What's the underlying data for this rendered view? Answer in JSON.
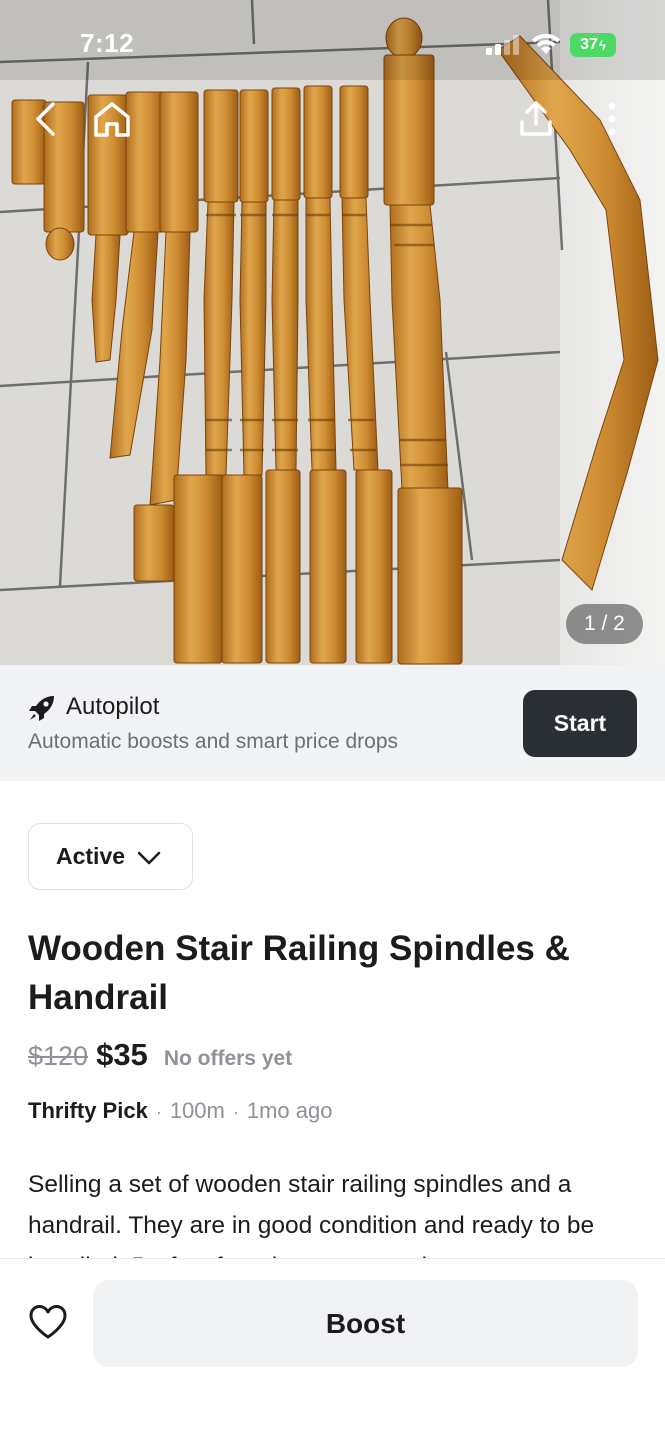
{
  "status_bar": {
    "time": "7:12",
    "battery": "37"
  },
  "hero": {
    "photo_subject": "wooden stair spindles and handrail",
    "counter": "1 / 2",
    "back_icon": "chevron-left-icon",
    "home_icon": "home-icon",
    "share_icon": "share-icon",
    "more_icon": "more-vertical-icon"
  },
  "autopilot": {
    "icon": "rocket-icon",
    "title": "Autopilot",
    "subtitle": "Automatic boosts and smart price drops",
    "start_label": "Start"
  },
  "listing": {
    "status": "Active",
    "title": "Wooden Stair Railing Spindles & Handrail",
    "original_price": "$120",
    "price": "$35",
    "offers": "No offers yet",
    "seller": "Thrifty Pick",
    "distance": "100m",
    "age": "1mo ago",
    "description": "Selling a set of wooden stair railing spindles and a handrail. They are in good condition and ready to be installed. Perfect for a home renovation"
  },
  "bottom_bar": {
    "favorite_icon": "heart-icon",
    "boost_label": "Boost"
  },
  "colors": {
    "primary_button": "#2a2f36",
    "banner_background": "#f2f3f5",
    "battery": "#4cd964",
    "muted_text": "#8e9299"
  }
}
